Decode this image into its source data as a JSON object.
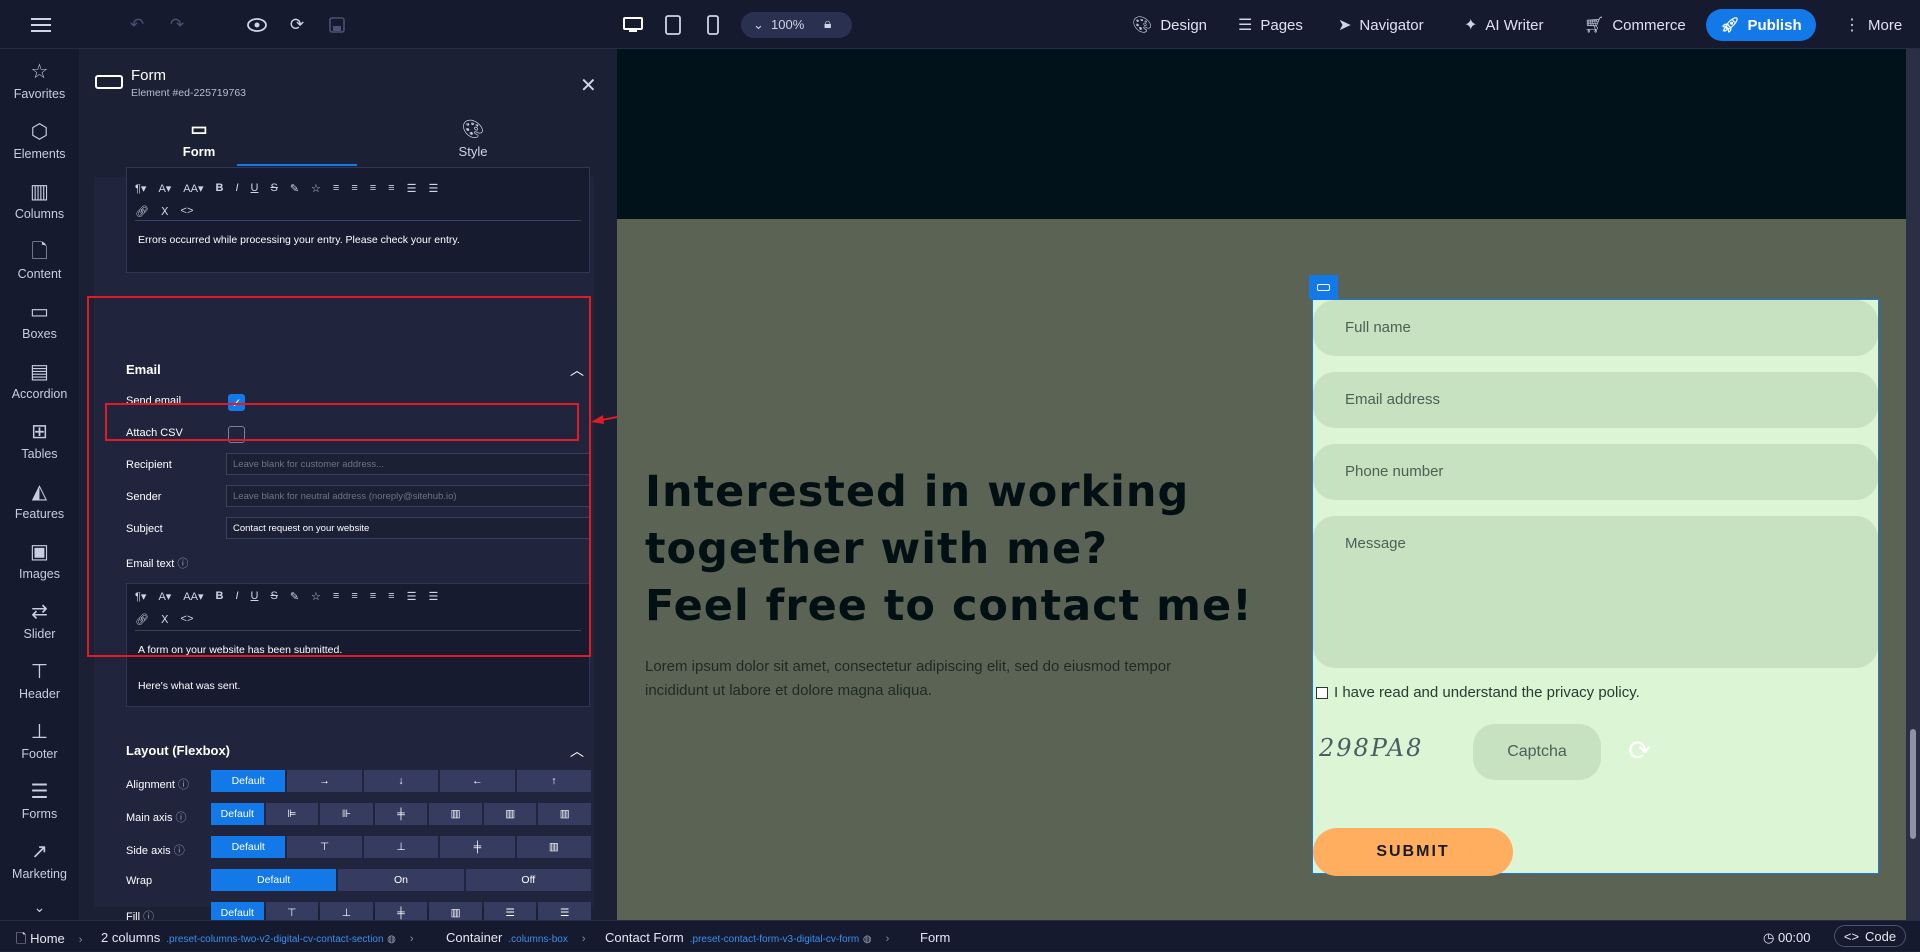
{
  "topbar": {
    "zoom": "100%",
    "menu": [
      {
        "name": "design",
        "icon": "palette-icon",
        "label": "Design"
      },
      {
        "name": "pages",
        "icon": "list-icon",
        "label": "Pages"
      },
      {
        "name": "navigator",
        "icon": "navigator-arrow-icon",
        "label": "Navigator"
      },
      {
        "name": "ai-writer",
        "icon": "sparkle-icon",
        "label": "AI Writer"
      },
      {
        "name": "commerce",
        "icon": "cart-icon",
        "label": "Commerce"
      }
    ],
    "publish_label": "Publish",
    "more_label": "More"
  },
  "sidebar": {
    "items": [
      {
        "label": "Favorites",
        "icon": "star-icon"
      },
      {
        "label": "Elements",
        "icon": "cube-icon"
      },
      {
        "label": "Columns",
        "icon": "columns-icon"
      },
      {
        "label": "Content",
        "icon": "document-icon"
      },
      {
        "label": "Boxes",
        "icon": "box-icon"
      },
      {
        "label": "Accordion",
        "icon": "accordion-icon"
      },
      {
        "label": "Tables",
        "icon": "table-icon"
      },
      {
        "label": "Features",
        "icon": "features-icon"
      },
      {
        "label": "Images",
        "icon": "image-icon"
      },
      {
        "label": "Slider",
        "icon": "slider-icon"
      },
      {
        "label": "Header",
        "icon": "header-icon"
      },
      {
        "label": "Footer",
        "icon": "footer-icon"
      },
      {
        "label": "Forms",
        "icon": "forms-icon"
      },
      {
        "label": "Marketing",
        "icon": "chart-line-icon"
      }
    ]
  },
  "panel": {
    "title": "Form",
    "element_id": "Element #ed-225719763",
    "tabs": [
      {
        "label": "Form",
        "icon": "form-icon"
      },
      {
        "label": "Style",
        "icon": "palette-icon"
      }
    ],
    "error_text": "Errors occurred while processing your entry. Please check your entry.",
    "email": {
      "title": "Email",
      "send_email_label": "Send email",
      "send_email_checked": true,
      "attach_csv_label": "Attach CSV",
      "attach_csv_checked": false,
      "recipient_label": "Recipient",
      "recipient_placeholder": "Leave blank for customer address...",
      "sender_label": "Sender",
      "sender_placeholder": "Leave blank for neutral address (noreply@sitehub.io)",
      "subject_label": "Subject",
      "subject_value": "Contact request on your website",
      "email_text_label": "Email text",
      "email_text_line1": "A form on your website has been submitted.",
      "email_text_line2": "Here's what was sent."
    },
    "layout": {
      "title": "Layout (Flexbox)",
      "rows": [
        {
          "label": "Alignment",
          "default": "Default"
        },
        {
          "label": "Main axis",
          "default": "Default"
        },
        {
          "label": "Side axis",
          "default": "Default"
        },
        {
          "label": "Wrap",
          "default": "Default",
          "options": [
            "On",
            "Off"
          ]
        },
        {
          "label": "Fill",
          "default": "Default"
        }
      ]
    }
  },
  "canvas": {
    "heading": "Interested in working\ntogether with me?\nFeel free to contact me!",
    "lorem": "Lorem ipsum dolor sit amet, consectetur adipiscing elit, sed do eiusmod tempor incididunt ut labore et dolore magna aliqua.",
    "form": {
      "full_name": "Full name",
      "email": "Email address",
      "phone": "Phone number",
      "message": "Message",
      "privacy": "I have read and understand the privacy policy.",
      "captcha_image_text": "298PA8",
      "captcha_placeholder": "Captcha",
      "submit": "SUBMIT"
    }
  },
  "breadcrumb": [
    {
      "label": "Home",
      "cls": ""
    },
    {
      "label": "2 columns",
      "cls": ".preset-columns-two-v2-digital-cv-contact-section"
    },
    {
      "label": "Container",
      "cls": ".columns-box"
    },
    {
      "label": "Contact Form",
      "cls": ".preset-contact-form-v3-digital-cv-form"
    },
    {
      "label": "Form",
      "cls": ""
    }
  ],
  "bottombar": {
    "time": "00:00",
    "code_label": "Code"
  },
  "colors": {
    "accent": "#1379e8",
    "annotation_red": "#e01b24",
    "submit": "#ffae60",
    "form_bg": "#dbf5d5"
  }
}
